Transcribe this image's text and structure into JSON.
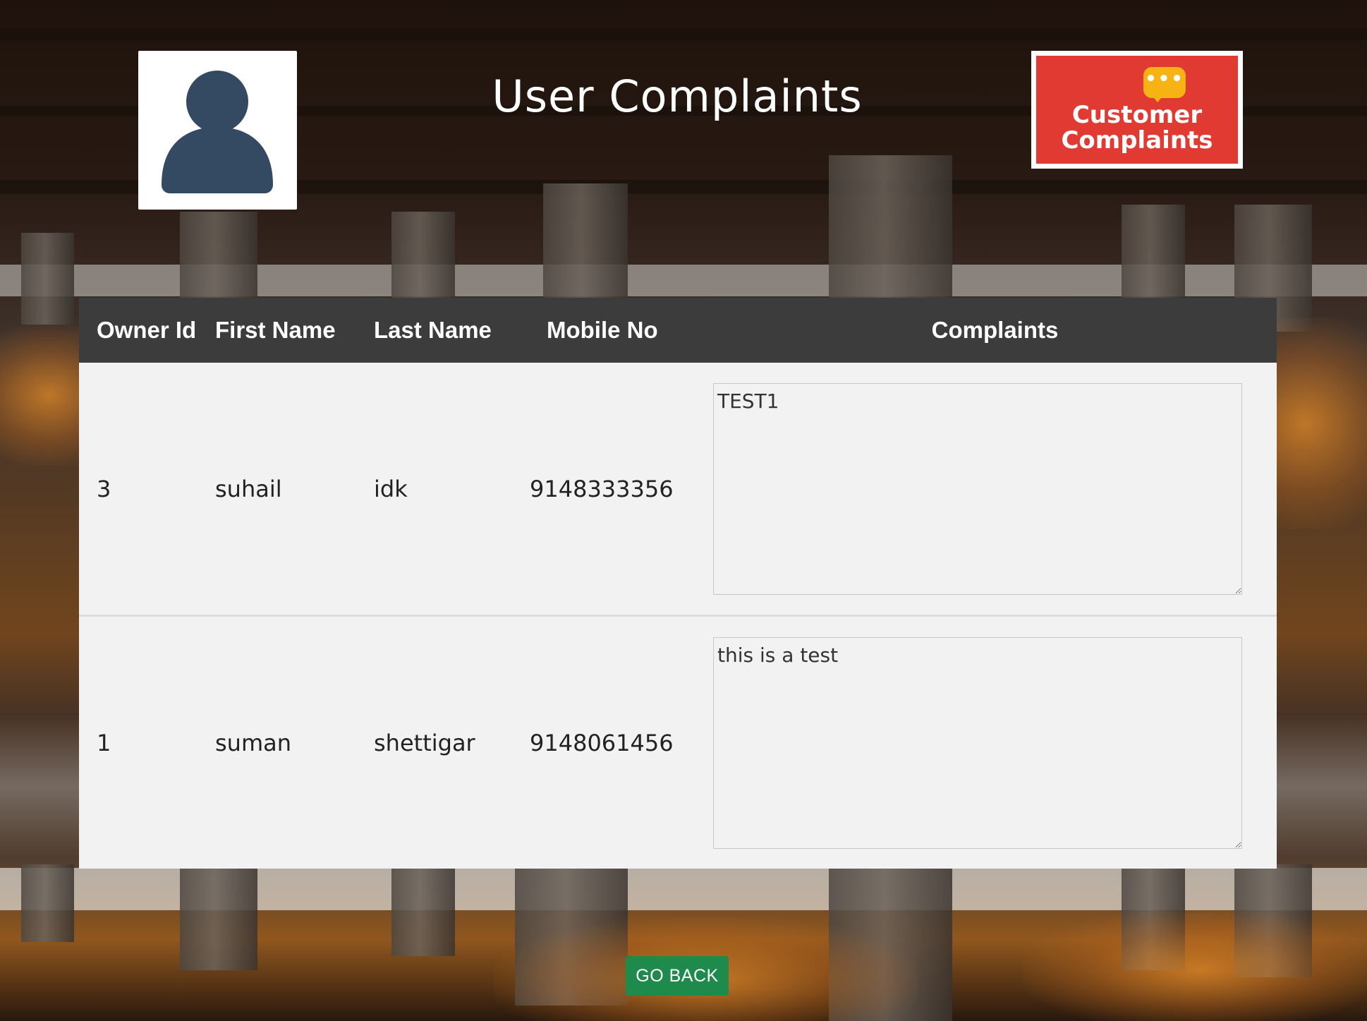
{
  "header": {
    "title": "User Complaints",
    "logo": {
      "line1": "Customer",
      "line2": "Complaints",
      "bubble_dots": "•••"
    },
    "avatar_icon": "user-silhouette-icon"
  },
  "table": {
    "columns": [
      "Owner Id",
      "First Name",
      "Last Name",
      "Mobile No",
      "Complaints"
    ],
    "rows": [
      {
        "owner_id": "3",
        "first_name": "suhail",
        "last_name": "idk",
        "mobile": "9148333356",
        "complaint": "TEST1"
      },
      {
        "owner_id": "1",
        "first_name": "suman",
        "last_name": "shettigar",
        "mobile": "9148061456",
        "complaint": "this is a test"
      }
    ]
  },
  "actions": {
    "go_back": "GO BACK"
  },
  "colors": {
    "header_bg": "#3c3c3c",
    "row_bg": "#f2f2f2",
    "button_green": "#1e8a4c",
    "logo_red": "#e03a33",
    "bubble_yellow": "#f7b214",
    "avatar_fill": "#344a63"
  }
}
